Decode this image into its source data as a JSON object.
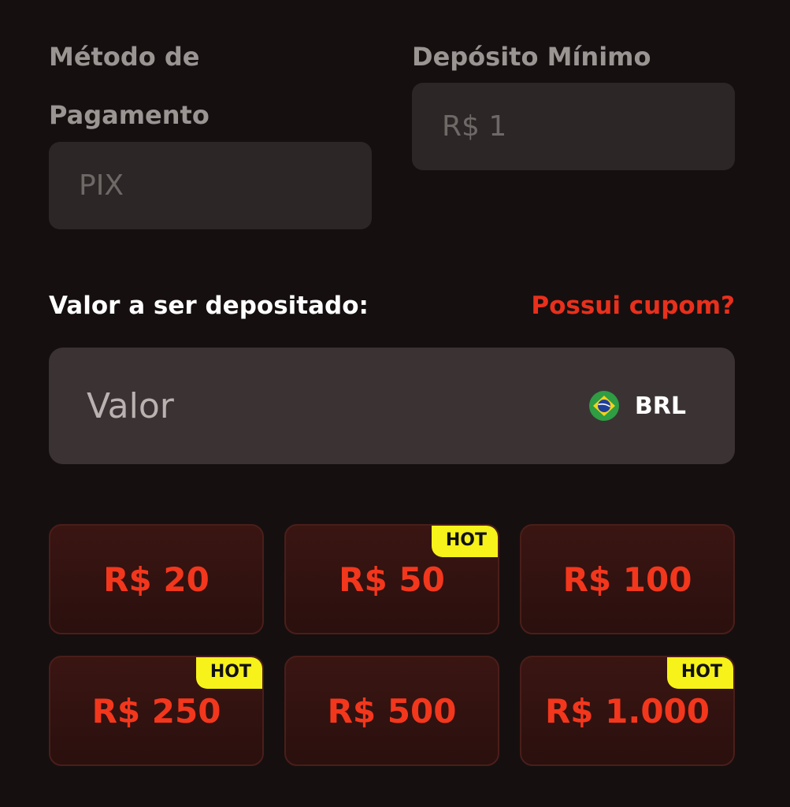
{
  "payment": {
    "method_label_line1": "Método de",
    "method_label_line2": "Pagamento",
    "method_value": "PIX",
    "min_label": "Depósito Mínimo",
    "min_value": "R$ 1"
  },
  "deposit": {
    "title": "Valor a ser depositado:",
    "coupon_link": "Possui cupom?",
    "amount_placeholder": "Valor",
    "currency": "BRL",
    "currency_icon": "brazil-flag-icon"
  },
  "chips": [
    {
      "label": "R$ 20",
      "hot": ""
    },
    {
      "label": "R$ 50",
      "hot": "HOT"
    },
    {
      "label": "R$ 100",
      "hot": ""
    },
    {
      "label": "R$ 250",
      "hot": "HOT"
    },
    {
      "label": "R$ 500",
      "hot": ""
    },
    {
      "label": "R$ 1.000",
      "hot": "HOT"
    }
  ],
  "colors": {
    "accent": "#e8301c",
    "hot_badge": "#f6f21a",
    "field_bg": "#2c2626"
  }
}
